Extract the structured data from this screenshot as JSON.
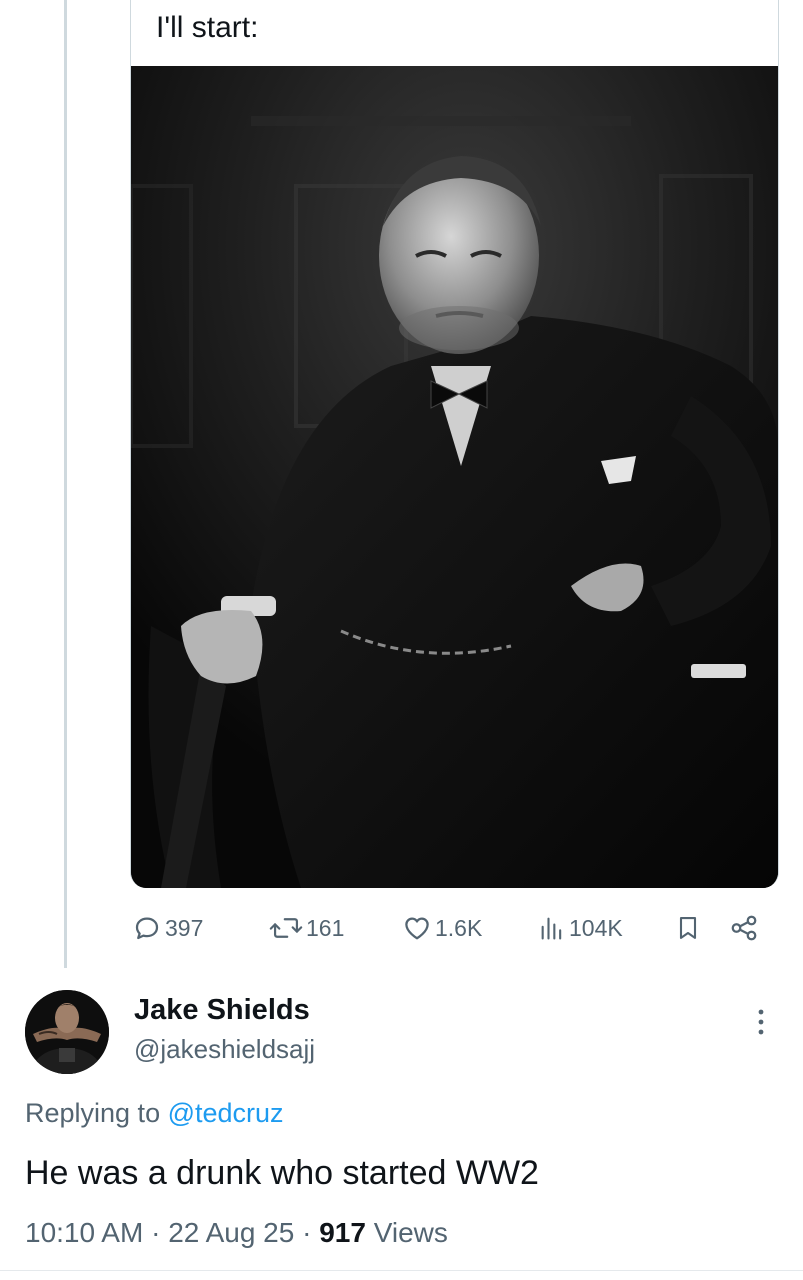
{
  "quoted_tweet": {
    "text": "I'll start:",
    "image_alt": "Black and white portrait of a man in a dark suit and bow tie, one hand on a chair, other hand on hip",
    "stats": {
      "replies": "397",
      "reposts": "161",
      "likes": "1.6K",
      "views": "104K"
    }
  },
  "reply": {
    "display_name": "Jake Shields",
    "handle": "@jakeshieldsajj",
    "replying_label": "Replying to ",
    "replying_to": "@tedcruz",
    "text": "He was a drunk who started WW2",
    "time": "10:10 AM",
    "separator": " · ",
    "date": "22 Aug 25",
    "view_count": "917",
    "views_label": " Views"
  },
  "icons": {
    "reply": "speech-bubble-icon",
    "repost": "repost-arrows-icon",
    "like": "heart-icon",
    "views": "bar-chart-icon",
    "bookmark": "bookmark-icon",
    "share": "share-icon",
    "more": "vertical-dots-icon"
  },
  "colors": {
    "text_primary": "#0f1419",
    "text_secondary": "#536471",
    "link": "#1d9bf0",
    "border": "#cfd9de"
  }
}
